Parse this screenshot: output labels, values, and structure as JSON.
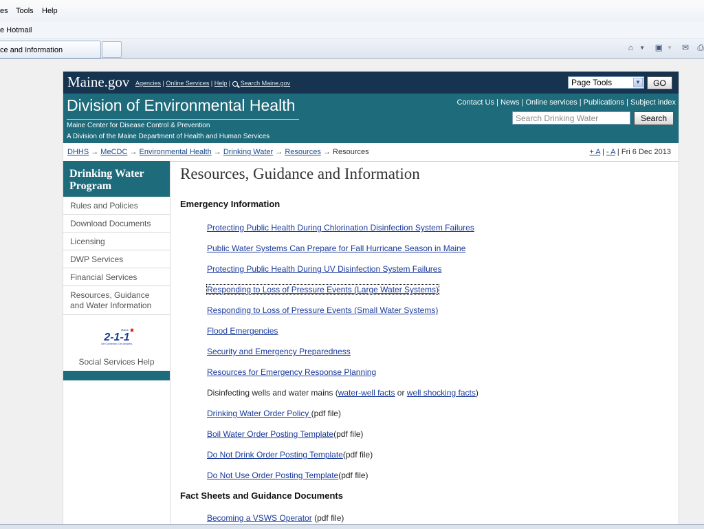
{
  "browser": {
    "menu": [
      "es",
      "Tools",
      "Help"
    ],
    "favorites_item": "e Hotmail",
    "active_tab": "ce and Information"
  },
  "header": {
    "logo": "Maine.gov",
    "topnav": [
      "Agencies",
      "Online Services",
      "Help",
      "Search Maine.gov"
    ],
    "page_tools": "Page Tools",
    "go_label": "GO",
    "dept_title": "Division of Environmental Health",
    "sub1": "Maine Center for Disease Control & Prevention",
    "sub2": "A Division of the Maine Department of Health and Human Services",
    "links": [
      "Contact Us",
      "News",
      "Online services",
      "Publications",
      "Subject index"
    ],
    "search_placeholder": "Search Drinking Water",
    "search_button": "Search"
  },
  "breadcrumb": {
    "items": [
      "DHHS",
      "MeCDC",
      "Environmental Health",
      "Drinking Water",
      "Resources"
    ],
    "current": "Resources",
    "font_increase": "+ A",
    "font_decrease": "- A",
    "date": "Fri 6 Dec 2013"
  },
  "sidebar": {
    "title": "Drinking Water Program",
    "items": [
      "Rules and Policies",
      "Download Documents",
      "Licensing",
      "DWP Services",
      "Financial Services",
      "Resources, Guidance and Water Information"
    ],
    "logo_text": "2-1-1",
    "logo_state": "Maine",
    "logo_tagline": "Get Connected. Get Answers.",
    "social_label": "Social Services Help"
  },
  "main": {
    "title": "Resources, Guidance and Information",
    "emergency_heading": "Emergency Information",
    "emergency_links": [
      "Protecting Public Health During Chlorination Disinfection System Failures",
      "Public Water Systems Can Prepare for Fall Hurricane Season in Maine",
      "Protecting Public Health During UV Disinfection System Failures",
      "Responding to Loss of Pressure Events (Large Water Systems)",
      "Responding to Loss of Pressure Events (Small Water Systems)",
      "Flood Emergencies",
      "Security and Emergency Preparedness",
      "Resources for Emergency Response Planning"
    ],
    "disinfect_text": "Disinfecting wells and water mains (",
    "disinfect_link1": "water-well facts",
    "disinfect_or": " or ",
    "disinfect_link2": "well shocking facts",
    "disinfect_end": ")",
    "pdf_links": [
      {
        "label": "Drinking Water Order Policy ",
        "suffix": "(pdf file)"
      },
      {
        "label": "Boil Water Order Posting Template",
        "suffix": "(pdf file)"
      },
      {
        "label": "Do Not Drink Order Posting Template",
        "suffix": "(pdf file)"
      },
      {
        "label": "Do Not Use Order Posting Template",
        "suffix": "(pdf file)"
      }
    ],
    "fact_heading": "Fact Sheets and Guidance Documents",
    "fact_links": [
      {
        "label": "Becoming a VSWS Operator",
        "suffix": " (pdf file)"
      }
    ]
  },
  "colors": {
    "top_bar": "#16334f",
    "teal": "#1e6b7b",
    "link": "#1a3a9a"
  }
}
